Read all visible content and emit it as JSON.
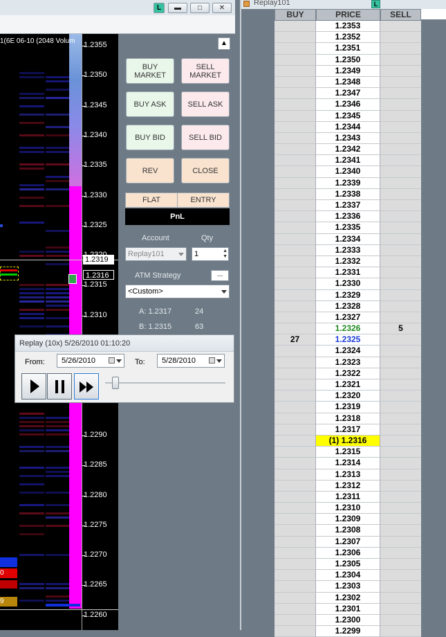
{
  "chart": {
    "title": "1(6E 06-10 (2048 Volum",
    "y_ticks": [
      "1.2355",
      "1.2350",
      "1.2345",
      "1.2340",
      "1.2335",
      "1.2330",
      "1.2325",
      "1.2320",
      "1.2315",
      "1.2310",
      "1.2290",
      "1.2285",
      "1.2280",
      "1.2275",
      "1.2270",
      "1.2265",
      "1.2260"
    ],
    "price_marker_upper": "1.2319",
    "price_marker_lower": "1.2316",
    "left_edge_labels": [
      "0",
      "9"
    ]
  },
  "order_panel": {
    "buy_market": "BUY MARKET",
    "sell_market": "SELL MARKET",
    "buy_ask": "BUY ASK",
    "sell_ask": "SELL ASK",
    "buy_bid": "BUY BID",
    "sell_bid": "SELL BID",
    "rev": "REV",
    "close": "CLOSE",
    "flat": "FLAT",
    "entry": "ENTRY",
    "pnl": "PnL",
    "account_label": "Account",
    "qty_label": "Qty",
    "account_value": "Replay101",
    "qty_value": "1",
    "atm_label": "ATM Strategy",
    "atm_more": "...",
    "atm_value": "<Custom>",
    "ask_label": "A: 1.2317",
    "ask_size": "24",
    "bid_label": "B: 1.2315",
    "bid_size": "63"
  },
  "replay": {
    "title": "Replay (10x) 5/26/2010 01:10:20",
    "from_label": "From:",
    "from_value": "5/26/2010",
    "to_label": "To:",
    "to_value": "5/28/2010",
    "speed_fraction": 0.1
  },
  "ladder": {
    "window_title": "Replay101",
    "columns": {
      "buy": "BUY",
      "price": "PRICE",
      "sell": "SELL"
    },
    "rows": [
      {
        "buy": "",
        "price": "1.2353",
        "sell": "",
        "style": "normal"
      },
      {
        "buy": "",
        "price": "1.2352",
        "sell": "",
        "style": "normal"
      },
      {
        "buy": "",
        "price": "1.2351",
        "sell": "",
        "style": "normal"
      },
      {
        "buy": "",
        "price": "1.2350",
        "sell": "",
        "style": "normal"
      },
      {
        "buy": "",
        "price": "1.2349",
        "sell": "",
        "style": "normal"
      },
      {
        "buy": "",
        "price": "1.2348",
        "sell": "",
        "style": "normal"
      },
      {
        "buy": "",
        "price": "1.2347",
        "sell": "",
        "style": "normal"
      },
      {
        "buy": "",
        "price": "1.2346",
        "sell": "",
        "style": "normal"
      },
      {
        "buy": "",
        "price": "1.2345",
        "sell": "",
        "style": "normal"
      },
      {
        "buy": "",
        "price": "1.2344",
        "sell": "",
        "style": "normal"
      },
      {
        "buy": "",
        "price": "1.2343",
        "sell": "",
        "style": "normal"
      },
      {
        "buy": "",
        "price": "1.2342",
        "sell": "",
        "style": "normal"
      },
      {
        "buy": "",
        "price": "1.2341",
        "sell": "",
        "style": "normal"
      },
      {
        "buy": "",
        "price": "1.2340",
        "sell": "",
        "style": "normal"
      },
      {
        "buy": "",
        "price": "1.2339",
        "sell": "",
        "style": "normal"
      },
      {
        "buy": "",
        "price": "1.2338",
        "sell": "",
        "style": "normal"
      },
      {
        "buy": "",
        "price": "1.2337",
        "sell": "",
        "style": "normal"
      },
      {
        "buy": "",
        "price": "1.2336",
        "sell": "",
        "style": "normal"
      },
      {
        "buy": "",
        "price": "1.2335",
        "sell": "",
        "style": "normal"
      },
      {
        "buy": "",
        "price": "1.2334",
        "sell": "",
        "style": "normal"
      },
      {
        "buy": "",
        "price": "1.2333",
        "sell": "",
        "style": "normal"
      },
      {
        "buy": "",
        "price": "1.2332",
        "sell": "",
        "style": "normal"
      },
      {
        "buy": "",
        "price": "1.2331",
        "sell": "",
        "style": "normal"
      },
      {
        "buy": "",
        "price": "1.2330",
        "sell": "",
        "style": "normal"
      },
      {
        "buy": "",
        "price": "1.2329",
        "sell": "",
        "style": "normal"
      },
      {
        "buy": "",
        "price": "1.2328",
        "sell": "",
        "style": "normal"
      },
      {
        "buy": "",
        "price": "1.2327",
        "sell": "",
        "style": "normal"
      },
      {
        "buy": "",
        "price": "1.2326",
        "sell": "5",
        "style": "ask"
      },
      {
        "buy": "27",
        "price": "1.2325",
        "sell": "",
        "style": "bid"
      },
      {
        "buy": "",
        "price": "1.2324",
        "sell": "",
        "style": "normal"
      },
      {
        "buy": "",
        "price": "1.2323",
        "sell": "",
        "style": "normal"
      },
      {
        "buy": "",
        "price": "1.2322",
        "sell": "",
        "style": "normal"
      },
      {
        "buy": "",
        "price": "1.2321",
        "sell": "",
        "style": "normal"
      },
      {
        "buy": "",
        "price": "1.2320",
        "sell": "",
        "style": "normal"
      },
      {
        "buy": "",
        "price": "1.2319",
        "sell": "",
        "style": "normal"
      },
      {
        "buy": "",
        "price": "1.2318",
        "sell": "",
        "style": "normal"
      },
      {
        "buy": "",
        "price": "1.2317",
        "sell": "",
        "style": "normal"
      },
      {
        "buy": "",
        "price": "(1) 1.2316",
        "sell": "",
        "style": "last"
      },
      {
        "buy": "",
        "price": "1.2315",
        "sell": "",
        "style": "normal"
      },
      {
        "buy": "",
        "price": "1.2314",
        "sell": "",
        "style": "normal"
      },
      {
        "buy": "",
        "price": "1.2313",
        "sell": "",
        "style": "normal"
      },
      {
        "buy": "",
        "price": "1.2312",
        "sell": "",
        "style": "normal"
      },
      {
        "buy": "",
        "price": "1.2311",
        "sell": "",
        "style": "normal"
      },
      {
        "buy": "",
        "price": "1.2310",
        "sell": "",
        "style": "normal"
      },
      {
        "buy": "",
        "price": "1.2309",
        "sell": "",
        "style": "normal"
      },
      {
        "buy": "",
        "price": "1.2308",
        "sell": "",
        "style": "normal"
      },
      {
        "buy": "",
        "price": "1.2307",
        "sell": "",
        "style": "normal"
      },
      {
        "buy": "",
        "price": "1.2306",
        "sell": "",
        "style": "normal"
      },
      {
        "buy": "",
        "price": "1.2305",
        "sell": "",
        "style": "normal"
      },
      {
        "buy": "",
        "price": "1.2304",
        "sell": "",
        "style": "normal"
      },
      {
        "buy": "",
        "price": "1.2303",
        "sell": "",
        "style": "normal"
      },
      {
        "buy": "",
        "price": "1.2302",
        "sell": "",
        "style": "normal"
      },
      {
        "buy": "",
        "price": "1.2301",
        "sell": "",
        "style": "normal"
      },
      {
        "buy": "",
        "price": "1.2300",
        "sell": "",
        "style": "normal"
      },
      {
        "buy": "",
        "price": "1.2299",
        "sell": "",
        "style": "normal"
      }
    ]
  },
  "colors": {
    "ask_text": "#1f8a1f",
    "bid_text": "#1a3ad8",
    "last_bg": "#ffff00",
    "volume_profile": "#ff00ff"
  }
}
